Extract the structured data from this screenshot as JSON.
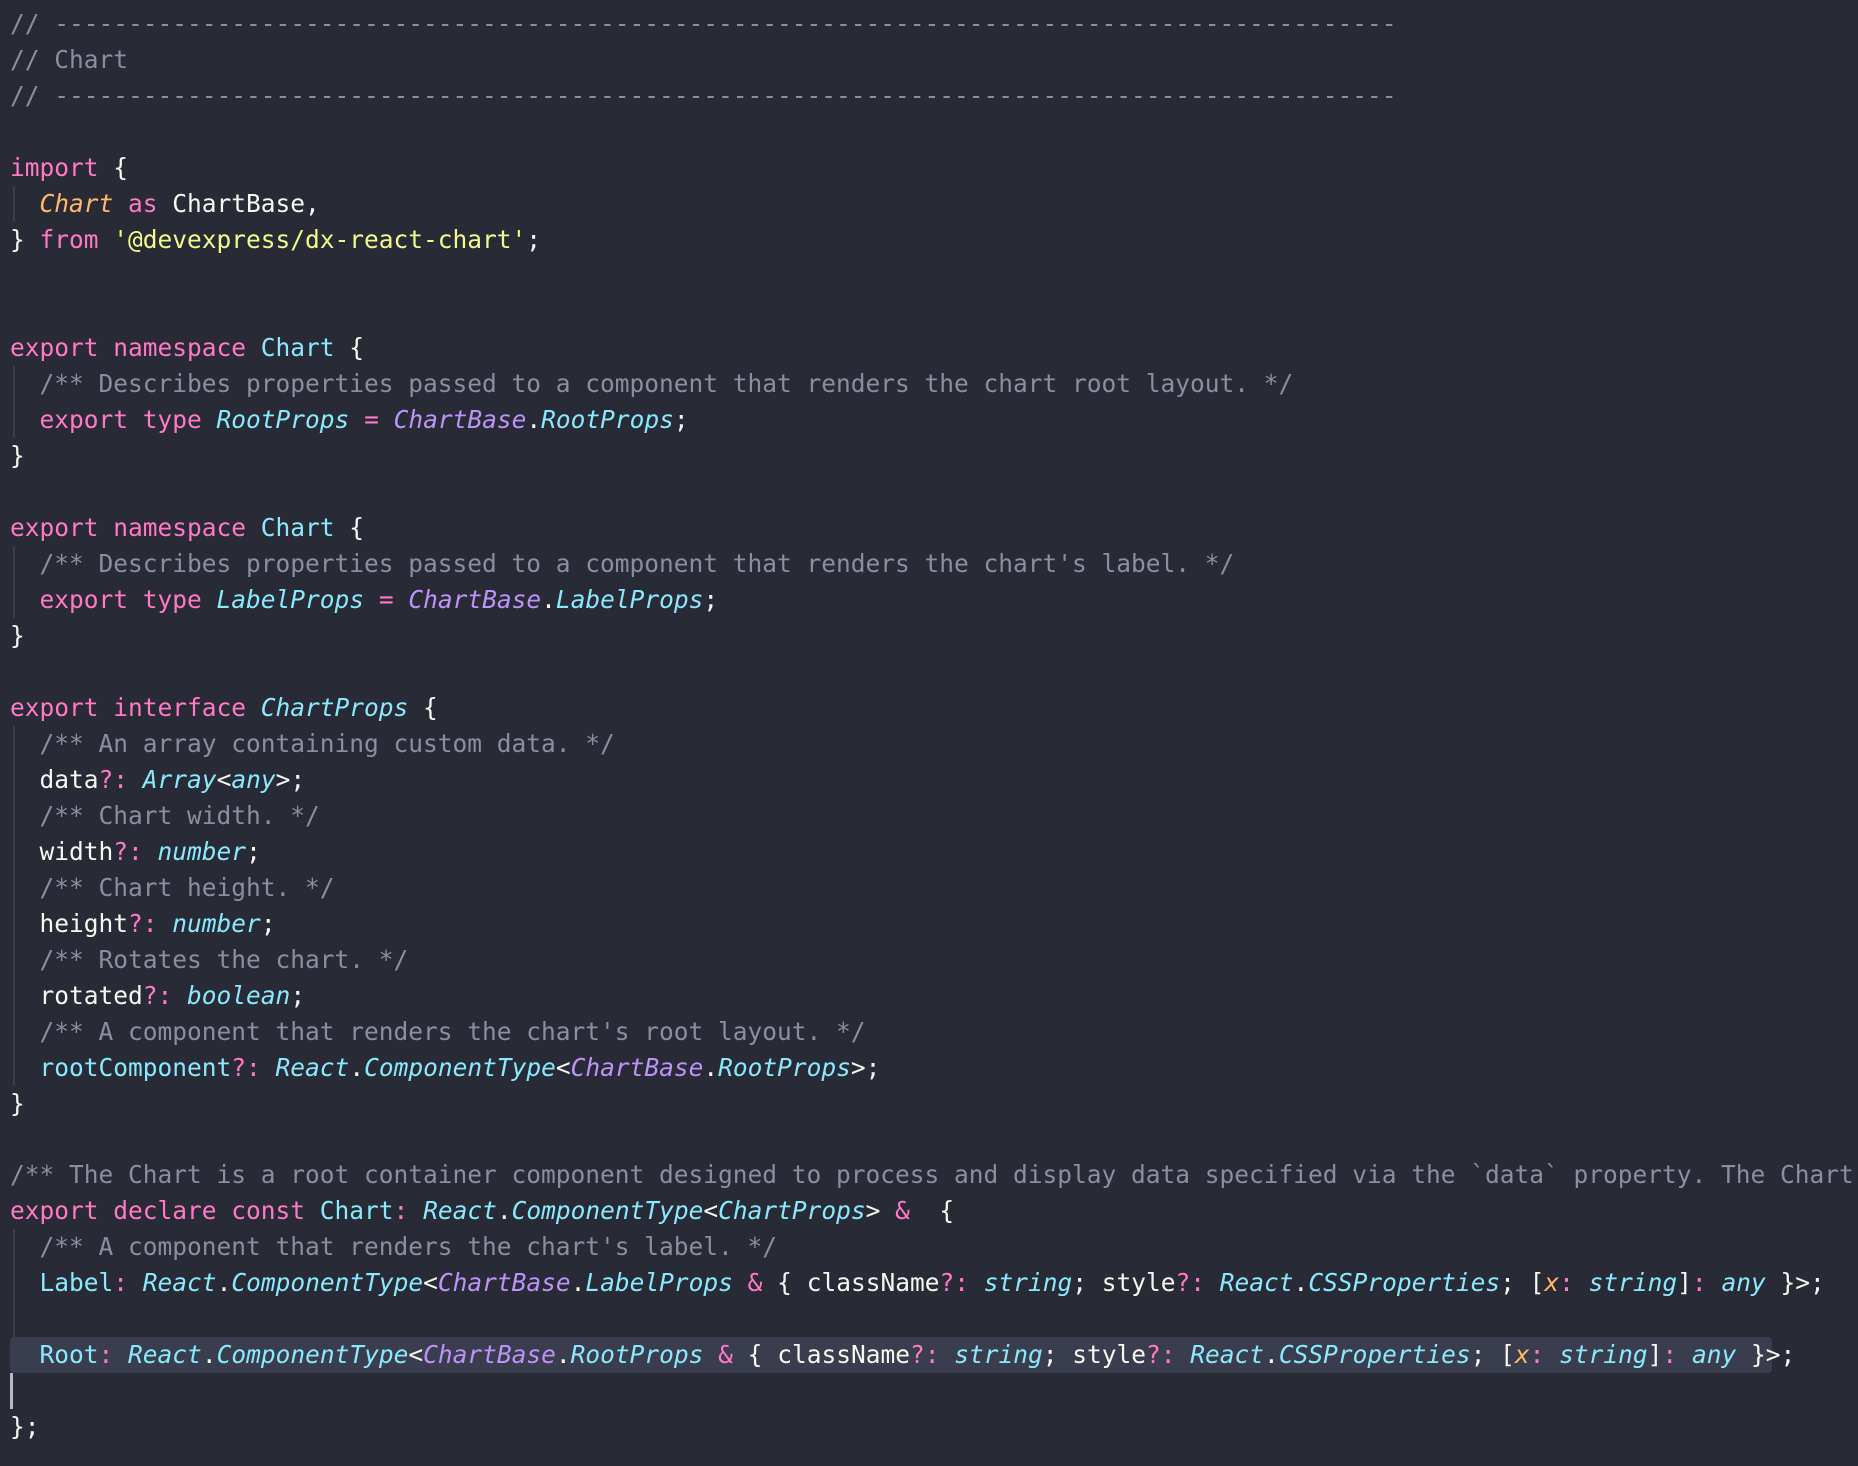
{
  "theme_colors": {
    "background": "#282a36",
    "keyword": "#ff79c6",
    "type": "#8be9fd",
    "namespace_ref": "#bd93f9",
    "string": "#f1fa8c",
    "comment": "#8a8e9e",
    "parameter": "#ffb86c",
    "text": "#f8f8f2",
    "current_line": "#3a3d4d"
  },
  "code": {
    "rule": "// -------------------------------------------------------------------------------------------",
    "section_title": "// Chart",
    "import_kw": "import",
    "open_brace": " {",
    "chart_name": "Chart",
    "as_kw": " as ",
    "chart_base_alias": "ChartBase,",
    "close_brace": "}",
    "from_kw": " from ",
    "module_path": "'@devexpress/dx-react-chart'",
    "semicolon": ";",
    "export_kw": "export",
    "namespace_kw": " namespace ",
    "type_kw": " type ",
    "equals": " = ",
    "dot": ".",
    "ns1_doc": "/** Describes properties passed to a component that renders the chart root layout. */",
    "root_props": "RootProps",
    "ns2_doc": "/** Describes properties passed to a component that renders the chart's label. */",
    "label_props": "LabelProps",
    "chart_base": "ChartBase",
    "interface_kw": " interface ",
    "chart_props": "ChartProps",
    "data_doc": "/** An array containing custom data. */",
    "data_field": "data",
    "optional_colon": "?: ",
    "array_type": "Array",
    "lt": "<",
    "gt": ">",
    "any_type": "any",
    "width_doc": "/** Chart width. */",
    "width_field": "width",
    "number_type": "number",
    "height_doc": "/** Chart height. */",
    "height_field": "height",
    "rotated_doc": "/** Rotates the chart. */",
    "rotated_field": "rotated",
    "boolean_type": "boolean",
    "root_component_doc": "/** A component that renders the chart's root layout. */",
    "root_component_field": "rootComponent",
    "react": "React",
    "component_type": "ComponentType",
    "main_doc": "/** The Chart is a root container component designed to process and display data specified via the `data` property. The Chart's",
    "declare_const_kw": " declare const ",
    "colon": ": ",
    "amp": " & ",
    "label_doc": "/** A component that renders the chart's label. */",
    "label_field": "Label",
    "root_field": "Root",
    "class_name_field": "className",
    "string_type": "string",
    "semi_space": "; ",
    "style_field": "style",
    "css_properties": "CSSProperties",
    "lbracket": "[",
    "x_param": "x",
    "rbracket": "]",
    "close_generic": " }>;",
    "close_decl": "};"
  }
}
